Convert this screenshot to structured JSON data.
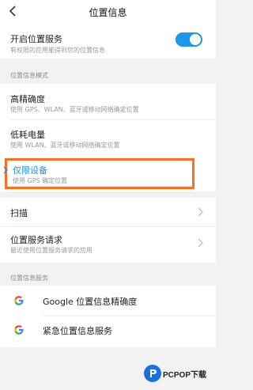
{
  "header": {
    "title": "位置信息",
    "back_icon": "back-arrow-icon"
  },
  "location_service": {
    "title": "开启位置服务",
    "subtitle": "有权限的应用能得到您的位置信息",
    "enabled": true,
    "toggle_color": "#1e96ea"
  },
  "mode_section": {
    "label": "位置信息模式",
    "options": [
      {
        "title": "高精确度",
        "subtitle": "使用 GPS、WLAN、蓝牙或移动网络确定位置"
      },
      {
        "title": "低耗电量",
        "subtitle": "使用 WLAN、蓝牙或移动网络确定位置"
      },
      {
        "title": "仅限设备",
        "subtitle": "使用 GPS 确定位置",
        "selected": true
      }
    ],
    "selected_color": "#1e96ea",
    "highlight_color": "#ff6d1f"
  },
  "scan": {
    "title": "扫描"
  },
  "requests": {
    "title": "位置服务请求",
    "subtitle": "最近使用位置服务请求的应用"
  },
  "services_section": {
    "label": "位置信息服务",
    "items": [
      {
        "title": "Google 位置信息精确度",
        "icon": "google-icon"
      },
      {
        "title": "紧急位置信息服务",
        "icon": "google-icon"
      }
    ]
  },
  "watermark": {
    "text": "PCPOP下载"
  }
}
